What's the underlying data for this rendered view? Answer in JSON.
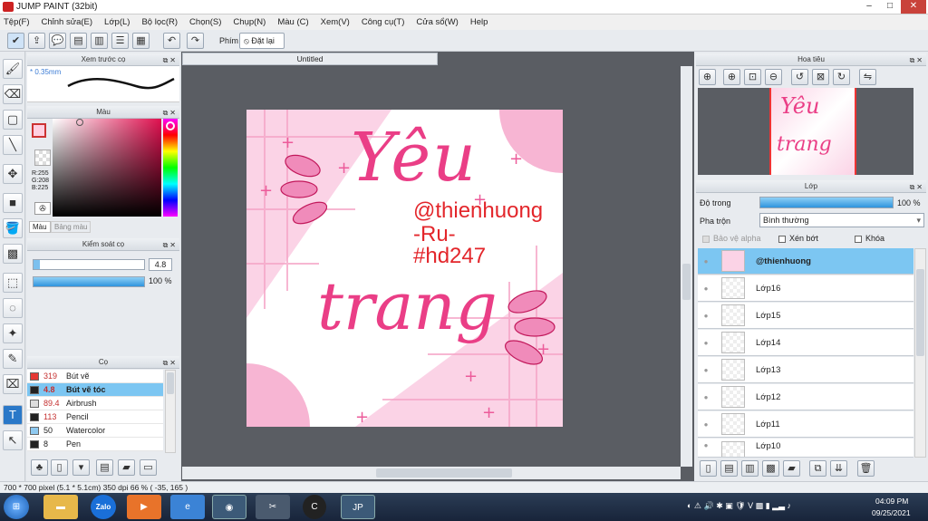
{
  "window": {
    "title": "JUMP PAINT (32bit)",
    "minimize": "–",
    "maximize": "□",
    "close": "✕"
  },
  "menu": [
    "Tệp(F)",
    "Chỉnh sửa(E)",
    "Lớp(L)",
    "Bộ lọc(R)",
    "Chọn(S)",
    "Chụp(N)",
    "Màu (C)",
    "Xem(V)",
    "Công cụ(T)",
    "Cửa sổ(W)",
    "Help"
  ],
  "toolbar": {
    "hotkey_label": "Phím",
    "reset_label": "Đặt lại"
  },
  "preview": {
    "title": "Xem trước cọ",
    "size": "* 0.35mm"
  },
  "color": {
    "title": "Màu",
    "r": "R:255",
    "g": "G:208",
    "b": "B:225",
    "tab_color": "Màu",
    "tab_palette": "Bảng màu",
    "main": "#ff6fa6"
  },
  "brush_control": {
    "title": "Kiểm soát cọ",
    "size": "4.8",
    "opacity": "100 %"
  },
  "brushes": {
    "title": "Cọ",
    "items": [
      {
        "size": "319",
        "name": "Bút vẽ",
        "color": "#e53935"
      },
      {
        "size": "4.8",
        "name": "Bút vẽ tóc",
        "color": "#222222"
      },
      {
        "size": "89.4",
        "name": "Airbrush",
        "color": "#dddddd"
      },
      {
        "size": "113",
        "name": "Pencil",
        "color": "#222222"
      },
      {
        "size": "50",
        "name": "Watercolor",
        "color": "#8ec9f0"
      },
      {
        "size": "8",
        "name": "Pen",
        "color": "#222222"
      }
    ]
  },
  "document": {
    "tab": "Untitled"
  },
  "artwork": {
    "line1": "Yêu",
    "line2": "trang",
    "handle": "@thienhuong",
    "suffix": "-Ru-",
    "tag": "#hd247"
  },
  "navigator": {
    "title": "Hoa tiêu"
  },
  "layers_panel": {
    "title": "Lớp",
    "opacity_label": "Độ trong",
    "opacity": "100 %",
    "blend_label": "Pha trộn",
    "blend": "Bình thường",
    "protect_alpha": "Bảo vệ alpha",
    "clip": "Xén bớt",
    "lock": "Khóa",
    "items": [
      "@thienhuong",
      "Lớp16",
      "Lớp15",
      "Lớp14",
      "Lớp13",
      "Lớp12",
      "Lớp11",
      "Lớp10"
    ]
  },
  "status": {
    "text": "700 * 700 pixel   (5.1 * 5.1cm)   350 dpi   66 %   ( -35, 165 )"
  },
  "taskbar": {
    "zalo": "Zalo",
    "time": "04:09 PM",
    "date": "09/25/2021"
  }
}
